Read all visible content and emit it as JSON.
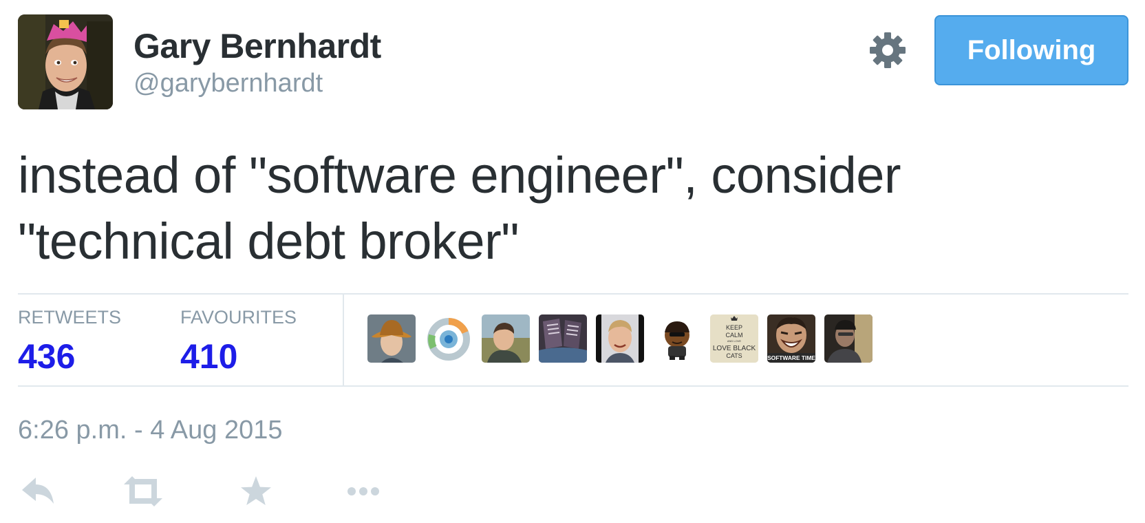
{
  "user": {
    "name": "Gary Bernhardt",
    "handle": "@garybernhardt"
  },
  "header": {
    "follow_label": "Following",
    "settings_icon": "gear-icon"
  },
  "tweet": {
    "text_line1": "instead of \"software engineer\", consider",
    "text_line2": "\"technical debt broker\"",
    "timestamp": "6:26 p.m. - 4 Aug 2015"
  },
  "stats": {
    "retweets_label": "RETWEETS",
    "retweets_count": "436",
    "favourites_label": "FAVOURITES",
    "favourites_count": "410"
  },
  "favouriters": [
    {
      "icon": "avatar-hat-person"
    },
    {
      "icon": "avatar-circle-logo"
    },
    {
      "icon": "avatar-man-outdoors"
    },
    {
      "icon": "avatar-shoes"
    },
    {
      "icon": "avatar-smiling-man"
    },
    {
      "icon": "avatar-cartoon"
    },
    {
      "icon": "avatar-keep-calm",
      "text": [
        "KEEP",
        "CALM",
        "AND LOVE",
        "LOVE BLACK",
        "CATS"
      ]
    },
    {
      "icon": "avatar-software-time",
      "text": "SOFTWARE TIME"
    },
    {
      "icon": "avatar-man-dark"
    }
  ],
  "actions": [
    "reply-icon",
    "retweet-icon",
    "favourite-icon",
    "more-icon"
  ],
  "colors": {
    "accent": "#55acee",
    "count": "#1d1de8",
    "muted": "#8899a6",
    "text": "#292f33"
  }
}
